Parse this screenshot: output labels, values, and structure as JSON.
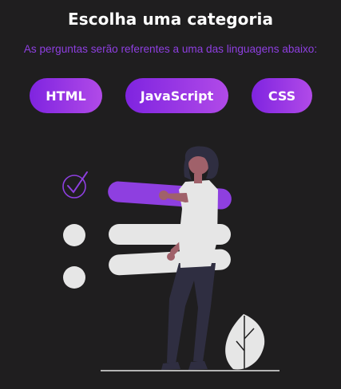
{
  "header": {
    "title": "Escolha uma categoria",
    "subtitle": "As perguntas serão referentes a uma das linguagens abaixo:"
  },
  "categories": [
    {
      "label": "HTML"
    },
    {
      "label": "JavaScript"
    },
    {
      "label": "CSS"
    }
  ],
  "colors": {
    "background": "#1f1e1f",
    "accent": "#8e3fe0",
    "button_gradient_start": "#7f24e0",
    "button_gradient_end": "#b14ae8",
    "title_text": "#ffffff"
  },
  "illustration": {
    "icon": "checklist-person-illustration"
  }
}
